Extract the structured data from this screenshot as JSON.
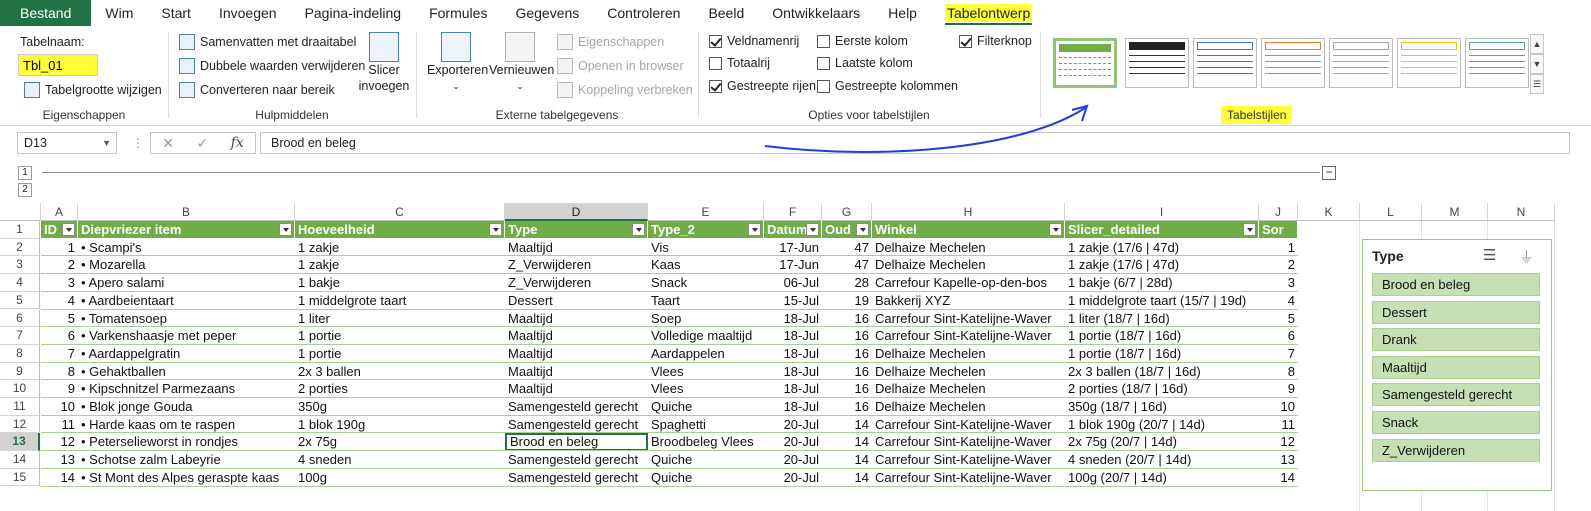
{
  "ribbon_tabs": [
    "Bestand",
    "Wim",
    "Start",
    "Invoegen",
    "Pagina-indeling",
    "Formules",
    "Gegevens",
    "Controleren",
    "Beeld",
    "Ontwikkelaars",
    "Help",
    "Tabelontwerp"
  ],
  "properties": {
    "table_name_label": "Tabelnaam:",
    "table_name_value": "Tbl_01",
    "resize": "Tabelgrootte wijzigen",
    "group": "Eigenschappen"
  },
  "tools": {
    "pivot": "Samenvatten met draaitabel",
    "dupes": "Dubbele waarden verwijderen",
    "convert": "Converteren naar bereik",
    "slicer1": "Slicer",
    "slicer2": "invoegen",
    "group": "Hulpmiddelen"
  },
  "external": {
    "export": "Exporteren",
    "refresh": "Vernieuwen",
    "props": "Eigenschappen",
    "browser": "Openen in browser",
    "unlink": "Koppeling verbreken",
    "group": "Externe tabelgegevens"
  },
  "options": {
    "header_row": "Veldnamenrij",
    "total_row": "Totaalrij",
    "banded_rows": "Gestreepte rijen",
    "first_col": "Eerste kolom",
    "last_col": "Laatste kolom",
    "banded_cols": "Gestreepte kolommen",
    "filter_btn": "Filterknop",
    "group": "Opties voor tabelstijlen"
  },
  "styles": {
    "group": "Tabelstijlen",
    "colors": [
      "#70ad47",
      "#222222",
      "#4472c4",
      "#ed7d31",
      "#a5a5a5",
      "#ffc000",
      "#5b9bd5"
    ]
  },
  "formula_bar": {
    "name_box": "D13",
    "fx": "fx",
    "content": "Brood en beleg"
  },
  "outline_levels": [
    "1",
    "2"
  ],
  "columns": [
    "A",
    "B",
    "C",
    "D",
    "E",
    "F",
    "G",
    "H",
    "I",
    "J",
    "K",
    "L",
    "M",
    "N"
  ],
  "headers": [
    "ID",
    "Diepvriezer item",
    "Hoeveelheid",
    "Type",
    "Type_2",
    "Datum",
    "Oud",
    "Winkel",
    "Slicer_detailed",
    "Sor"
  ],
  "rows": [
    [
      "1",
      "• Scampi's",
      "1 zakje",
      "Maaltijd",
      "Vis",
      "17-Jun",
      "47",
      "Delhaize Mechelen",
      "1 zakje (17/6 | 47d)",
      "1"
    ],
    [
      "2",
      "• Mozarella",
      "1 zakje",
      "Z_Verwijderen",
      "Kaas",
      "17-Jun",
      "47",
      "Delhaize Mechelen",
      "1 zakje (17/6 | 47d)",
      "2"
    ],
    [
      "3",
      "• Apero salami",
      "1 bakje",
      "Z_Verwijderen",
      "Snack",
      "06-Jul",
      "28",
      "Carrefour Kapelle-op-den-bos",
      "1 bakje (6/7 | 28d)",
      "3"
    ],
    [
      "4",
      "• Aardbeientaart",
      "1 middelgrote taart",
      "Dessert",
      "Taart",
      "15-Jul",
      "19",
      "Bakkerij XYZ",
      "1 middelgrote taart (15/7 | 19d)",
      "4"
    ],
    [
      "5",
      "• Tomatensoep",
      "1 liter",
      "Maaltijd",
      "Soep",
      "18-Jul",
      "16",
      "Carrefour Sint-Katelijne-Waver",
      "1 liter (18/7 | 16d)",
      "5"
    ],
    [
      "6",
      "• Varkenshaasje met peper",
      "1 portie",
      "Maaltijd",
      "Volledige maaltijd",
      "18-Jul",
      "16",
      "Carrefour Sint-Katelijne-Waver",
      "1 portie (18/7 | 16d)",
      "6"
    ],
    [
      "7",
      "• Aardappelgratin",
      "1 portie",
      "Maaltijd",
      "Aardappelen",
      "18-Jul",
      "16",
      "Delhaize Mechelen",
      "1 portie (18/7 | 16d)",
      "7"
    ],
    [
      "8",
      "• Gehaktballen",
      "2x 3 ballen",
      "Maaltijd",
      "Vlees",
      "18-Jul",
      "16",
      "Delhaize Mechelen",
      "2x 3 ballen (18/7 | 16d)",
      "8"
    ],
    [
      "9",
      "• Kipschnitzel Parmezaans",
      "2 porties",
      "Maaltijd",
      "Vlees",
      "18-Jul",
      "16",
      "Delhaize Mechelen",
      "2 porties (18/7 | 16d)",
      "9"
    ],
    [
      "10",
      "• Blok jonge Gouda",
      "350g",
      "Samengesteld gerecht",
      "Quiche",
      "18-Jul",
      "16",
      "Delhaize Mechelen",
      "350g (18/7 | 16d)",
      "10"
    ],
    [
      "11",
      "• Harde kaas om te raspen",
      "1 blok 190g",
      "Samengesteld gerecht",
      "Spaghetti",
      "20-Jul",
      "14",
      "Carrefour Sint-Katelijne-Waver",
      "1 blok 190g (20/7 | 14d)",
      "11"
    ],
    [
      "12",
      "• Peterselieworst in rondjes",
      "2x 75g",
      "Brood en beleg",
      "Broodbeleg Vlees",
      "20-Jul",
      "14",
      "Carrefour Sint-Katelijne-Waver",
      "2x 75g (20/7 | 14d)",
      "12"
    ],
    [
      "13",
      "• Schotse zalm Labeyrie",
      "4 sneden",
      "Samengesteld gerecht",
      "Quiche",
      "20-Jul",
      "14",
      "Carrefour Sint-Katelijne-Waver",
      "4 sneden (20/7 | 14d)",
      "13"
    ],
    [
      "14",
      "• St Mont des Alpes geraspte kaas",
      "100g",
      "Samengesteld gerecht",
      "Quiche",
      "20-Jul",
      "14",
      "Carrefour Sint-Katelijne-Waver",
      "100g (20/7 | 14d)",
      "14"
    ]
  ],
  "row_numbers": [
    "1",
    "2",
    "3",
    "4",
    "5",
    "6",
    "7",
    "8",
    "9",
    "10",
    "11",
    "12",
    "13",
    "14",
    "15"
  ],
  "slicer": {
    "title": "Type",
    "items": [
      "Brood en beleg",
      "Dessert",
      "Drank",
      "Maaltijd",
      "Samengesteld gerecht",
      "Snack",
      "Z_Verwijderen"
    ]
  }
}
